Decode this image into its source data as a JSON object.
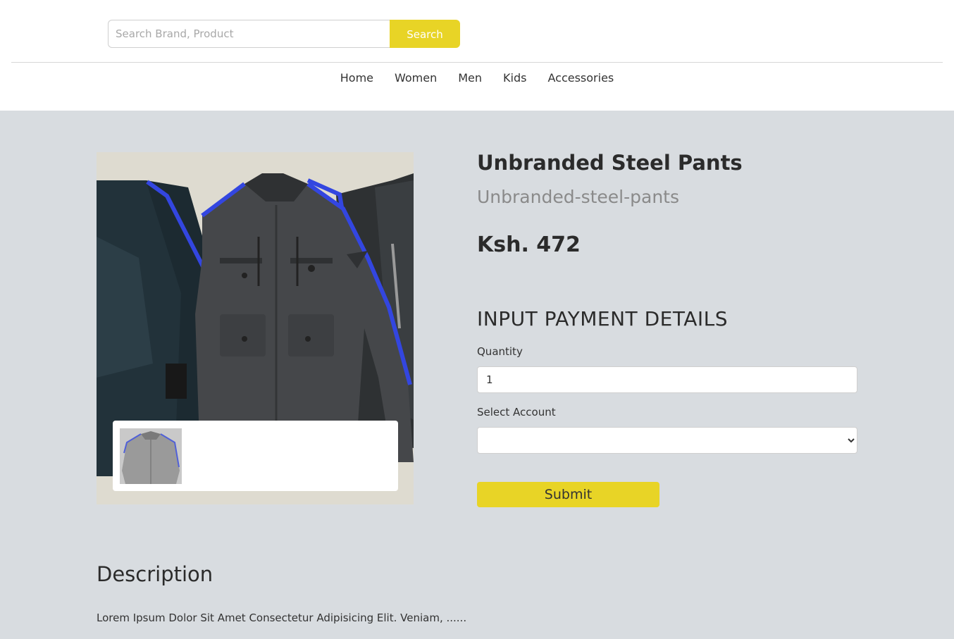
{
  "header": {
    "search": {
      "placeholder": "Search Brand, Product",
      "value": "",
      "button_label": "Search"
    },
    "nav": [
      "Home",
      "Women",
      "Men",
      "Kids",
      "Accessories"
    ]
  },
  "product": {
    "title": "Unbranded Steel Pants",
    "slug": "Unbranded-steel-pants",
    "price": "Ksh. 472",
    "image_description": "jacket-photo"
  },
  "payment": {
    "heading": "INPUT PAYMENT DETAILS",
    "quantity_label": "Quantity",
    "quantity_value": "1",
    "account_label": "Select Account",
    "account_value": "",
    "submit_label": "Submit"
  },
  "description": {
    "heading": "Description",
    "text": "Lorem Ipsum Dolor Sit Amet Consectetur Adipisicing Elit. Veniam, ......"
  },
  "colors": {
    "accent": "#e8d426",
    "background": "#d8dce0"
  }
}
